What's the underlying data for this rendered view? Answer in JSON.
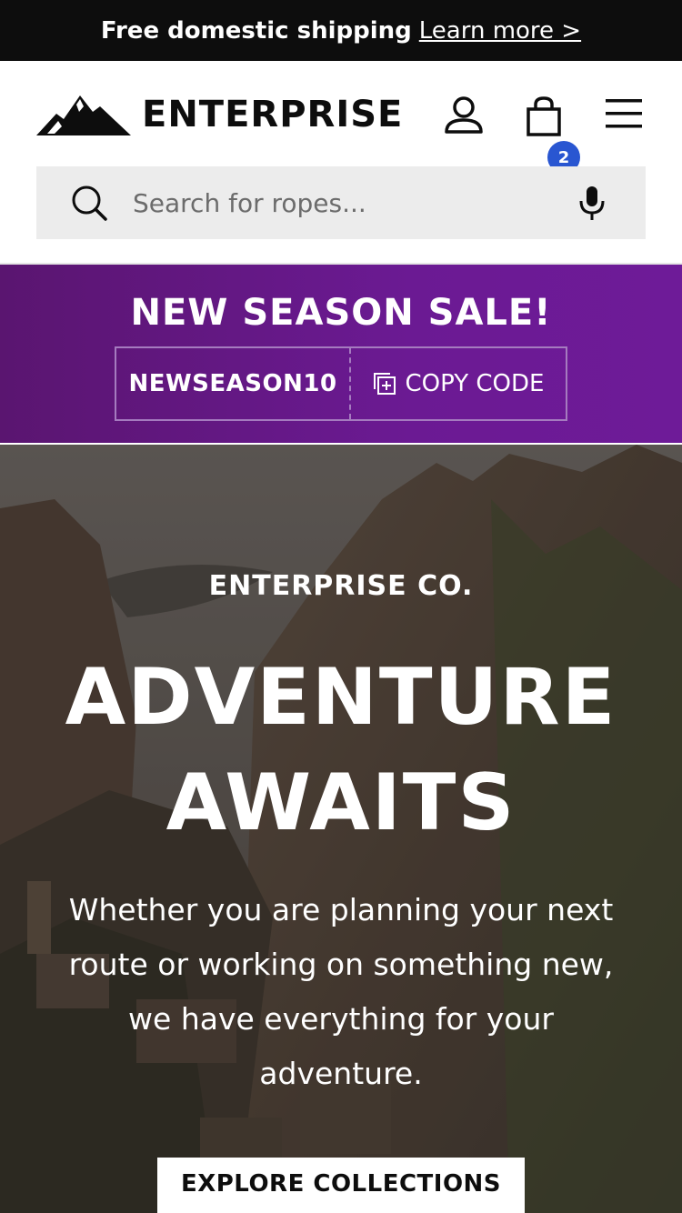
{
  "announcement": {
    "text": "Free domestic shipping",
    "link": "Learn more >"
  },
  "header": {
    "brand": "ENTERPRISE",
    "logo_icon": "mountain-logo",
    "account_icon": "user-icon",
    "cart_icon": "bag-icon",
    "cart_count": "2",
    "menu_icon": "hamburger-icon"
  },
  "search": {
    "placeholder": "Search for ropes...",
    "icon": "search-icon",
    "mic_icon": "microphone-icon"
  },
  "promo": {
    "title": "NEW SEASON SALE!",
    "code": "NEWSEASON10",
    "copy_label": "COPY CODE"
  },
  "hero": {
    "eyebrow": "ENTERPRISE CO.",
    "headline_line1": "ADVENTURE",
    "headline_line2": "AWAITS",
    "description": "Whether you are planning your next route or working on something new, we have everything for your adventure.",
    "cta_label": "EXPLORE COLLECTIONS"
  },
  "colors": {
    "topbar": "#0d0d0d",
    "promo": "#6b1a93",
    "badge": "#2956d1"
  }
}
